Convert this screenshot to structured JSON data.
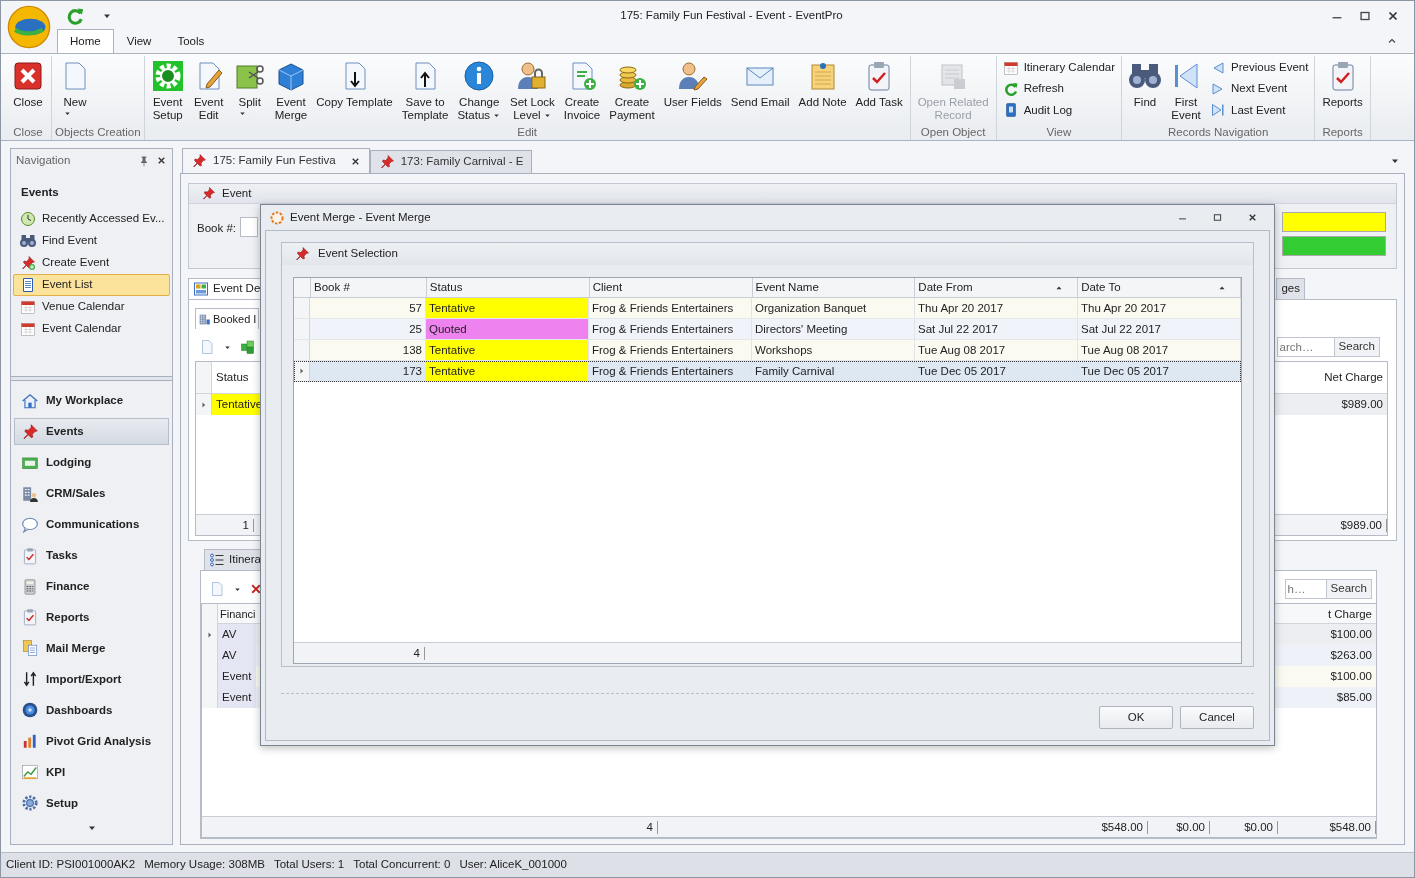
{
  "window": {
    "title": "175: Family Fun Festival - Event - EventPro"
  },
  "ribbon": {
    "tabs": [
      {
        "label": "Home",
        "selected": true
      },
      {
        "label": "View",
        "selected": false
      },
      {
        "label": "Tools",
        "selected": false
      }
    ],
    "groups": [
      {
        "label": "Close",
        "buttons": [
          {
            "kind": "large",
            "label": "Close"
          }
        ]
      },
      {
        "label": "Objects Creation",
        "buttons": [
          {
            "kind": "large",
            "label": "New",
            "dropdown": true
          }
        ]
      },
      {
        "label": "Edit",
        "buttons": [
          {
            "kind": "large",
            "label": "Event\nSetup",
            "dropdown": false
          },
          {
            "kind": "large",
            "label": "Event\nEdit",
            "dropdown": false
          },
          {
            "kind": "large",
            "label": "Split",
            "dropdown": true
          },
          {
            "kind": "large",
            "label": "Event\nMerge",
            "dropdown": false
          },
          {
            "kind": "large",
            "label": "Copy Template",
            "dropdown": false
          },
          {
            "kind": "large",
            "label": "Save to\nTemplate",
            "dropdown": false
          },
          {
            "kind": "large",
            "label": "Change\nStatus",
            "dropdown": true
          },
          {
            "kind": "large",
            "label": "Set Lock\nLevel",
            "dropdown": true
          },
          {
            "kind": "large",
            "label": "Create\nInvoice",
            "dropdown": false
          },
          {
            "kind": "large",
            "label": "Create\nPayment",
            "dropdown": false
          },
          {
            "kind": "large",
            "label": "User Fields",
            "dropdown": false
          },
          {
            "kind": "large",
            "label": "Send Email",
            "dropdown": false
          },
          {
            "kind": "large",
            "label": "Add Note",
            "dropdown": false
          },
          {
            "kind": "large",
            "label": "Add Task",
            "dropdown": false
          }
        ]
      },
      {
        "label": "Open Object",
        "buttons": [
          {
            "kind": "large",
            "label": "Open Related\nRecord",
            "disabled": true
          }
        ]
      },
      {
        "label": "View",
        "buttons": [
          {
            "kind": "small",
            "label": "Itinerary Calendar"
          },
          {
            "kind": "small",
            "label": "Refresh"
          },
          {
            "kind": "small",
            "label": "Audit Log"
          }
        ]
      },
      {
        "label": "Records Navigation",
        "buttons": [
          {
            "kind": "large",
            "label": "Find"
          },
          {
            "kind": "large",
            "label": "First\nEvent"
          },
          {
            "kind": "small",
            "label": "Previous Event"
          },
          {
            "kind": "small",
            "label": "Next Event"
          },
          {
            "kind": "small",
            "label": "Last Event"
          }
        ]
      },
      {
        "label": "Reports",
        "buttons": [
          {
            "kind": "large",
            "label": "Reports"
          }
        ]
      }
    ]
  },
  "navigation": {
    "title": "Navigation",
    "section": "Events",
    "items": [
      {
        "label": "Recently Accessed Ev...",
        "selected": false
      },
      {
        "label": "Find Event",
        "selected": false
      },
      {
        "label": "Create Event",
        "selected": false
      },
      {
        "label": "Event List",
        "selected": true
      },
      {
        "label": "Venue Calendar",
        "selected": false
      },
      {
        "label": "Event Calendar",
        "selected": false
      }
    ],
    "modules": [
      {
        "label": "My Workplace",
        "selected": false
      },
      {
        "label": "Events",
        "selected": true
      },
      {
        "label": "Lodging",
        "selected": false
      },
      {
        "label": "CRM/Sales",
        "selected": false
      },
      {
        "label": "Communications",
        "selected": false
      },
      {
        "label": "Tasks",
        "selected": false
      },
      {
        "label": "Finance",
        "selected": false
      },
      {
        "label": "Reports",
        "selected": false
      },
      {
        "label": "Mail Merge",
        "selected": false
      },
      {
        "label": "Import/Export",
        "selected": false
      },
      {
        "label": "Dashboards",
        "selected": false
      },
      {
        "label": "Pivot Grid Analysis",
        "selected": false
      },
      {
        "label": "KPI",
        "selected": false
      },
      {
        "label": "Setup",
        "selected": false
      }
    ]
  },
  "document_tabs": [
    {
      "label": "175: Family Fun Festiva",
      "selected": true,
      "close_button": true
    },
    {
      "label": "173: Family Carnival - E",
      "selected": false,
      "close_button": false
    }
  ],
  "event_panel": {
    "title": "Event",
    "book_label": "Book #:",
    "bars": [
      {
        "color": "#ffff00"
      },
      {
        "color": "#33cc33"
      }
    ]
  },
  "details": {
    "tabs": [
      {
        "label": "Event De",
        "selected": true
      },
      {
        "label": "ges",
        "selected": false
      }
    ],
    "booked_tab": "Booked I",
    "search": {
      "placeholder": "arch…",
      "button": "Search"
    },
    "columns": [
      "Status",
      "Net Charge"
    ],
    "rows": [
      {
        "status": "Tentative",
        "color": "#ffff00",
        "net_charge": "$989.00"
      }
    ],
    "footer": [
      "1",
      "$989.00"
    ]
  },
  "itinerary": {
    "tab": "Itinera",
    "search": {
      "placeholder": "h…",
      "button": "Search"
    },
    "columns": [
      "Financi",
      "t Charge"
    ],
    "rows": [
      {
        "category": "AV",
        "net_charge": "$100.00"
      },
      {
        "category": "AV",
        "net_charge": "$263.00"
      },
      {
        "category": "Event",
        "net_charge": "$100.00"
      },
      {
        "category": "Event",
        "net_charge": "$85.00"
      }
    ],
    "footer": [
      "4",
      "$548.00",
      "$0.00",
      "$0.00",
      "$548.00"
    ]
  },
  "dialog": {
    "title": "Event Merge - Event Merge",
    "group_title": "Event Selection",
    "columns": [
      {
        "label": "Book #",
        "sorted": false
      },
      {
        "label": "Status",
        "sorted": false
      },
      {
        "label": "Client",
        "sorted": false
      },
      {
        "label": "Event Name",
        "sorted": false
      },
      {
        "label": "Date From",
        "sorted": true
      },
      {
        "label": "Date To",
        "sorted": true
      }
    ],
    "rows": [
      {
        "book": "57",
        "status": "Tentative",
        "color": "#ffff00",
        "client": "Frog & Friends Entertainers",
        "event_name": "Organization Banquet",
        "date_from": "Thu Apr 20 2017",
        "date_to": "Thu Apr 20 2017",
        "selected": false
      },
      {
        "book": "25",
        "status": "Quoted",
        "color": "#ee82ee",
        "client": "Frog & Friends Entertainers",
        "event_name": "Directors' Meeting",
        "date_from": "Sat Jul 22 2017",
        "date_to": "Sat Jul 22 2017",
        "selected": false
      },
      {
        "book": "138",
        "status": "Tentative",
        "color": "#ffff00",
        "client": "Frog & Friends Entertainers",
        "event_name": "Workshops",
        "date_from": "Tue Aug 08 2017",
        "date_to": "Tue Aug 08 2017",
        "selected": false
      },
      {
        "book": "173",
        "status": "Tentative",
        "color": "#ffff00",
        "client": "Frog & Friends Entertainers",
        "event_name": "Family Carnival",
        "date_from": "Tue Dec 05 2017",
        "date_to": "Tue Dec 05 2017",
        "selected": true
      }
    ],
    "footer_count": "4",
    "buttons": [
      "OK",
      "Cancel"
    ]
  },
  "status_bar": {
    "items": [
      "Client ID: PSI001000AK2",
      "Memory Usage: 308MB",
      "Total Users: 1",
      "Total Concurrent: 0",
      "User: AliceK_001000"
    ]
  }
}
